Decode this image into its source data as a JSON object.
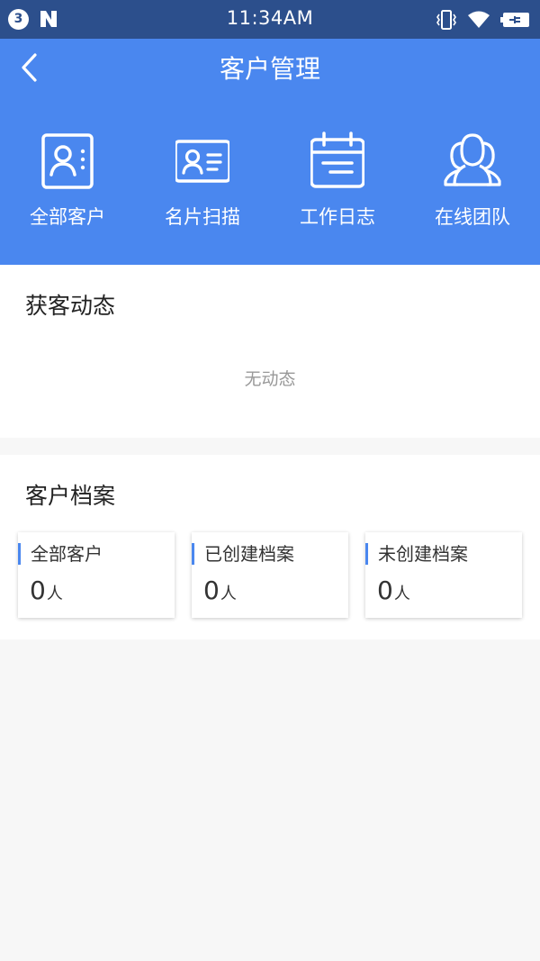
{
  "status_bar": {
    "notification_count": "3",
    "time": "11:34AM"
  },
  "header": {
    "title": "客户管理"
  },
  "shortcuts": [
    {
      "label": "全部客户",
      "icon": "contacts-book-icon"
    },
    {
      "label": "名片扫描",
      "icon": "business-card-icon"
    },
    {
      "label": "工作日志",
      "icon": "calendar-log-icon"
    },
    {
      "label": "在线团队",
      "icon": "team-icon"
    }
  ],
  "feed": {
    "title": "获客动态",
    "empty_text": "无动态"
  },
  "archive": {
    "title": "客户档案",
    "stats": [
      {
        "label": "全部客户",
        "value": "0",
        "unit": "人"
      },
      {
        "label": "已创建档案",
        "value": "0",
        "unit": "人"
      },
      {
        "label": "未创建档案",
        "value": "0",
        "unit": "人"
      }
    ]
  },
  "colors": {
    "status_bar": "#2c4f8c",
    "header": "#4a87ef",
    "accent": "#4a87ef",
    "background": "#f7f7f7"
  }
}
